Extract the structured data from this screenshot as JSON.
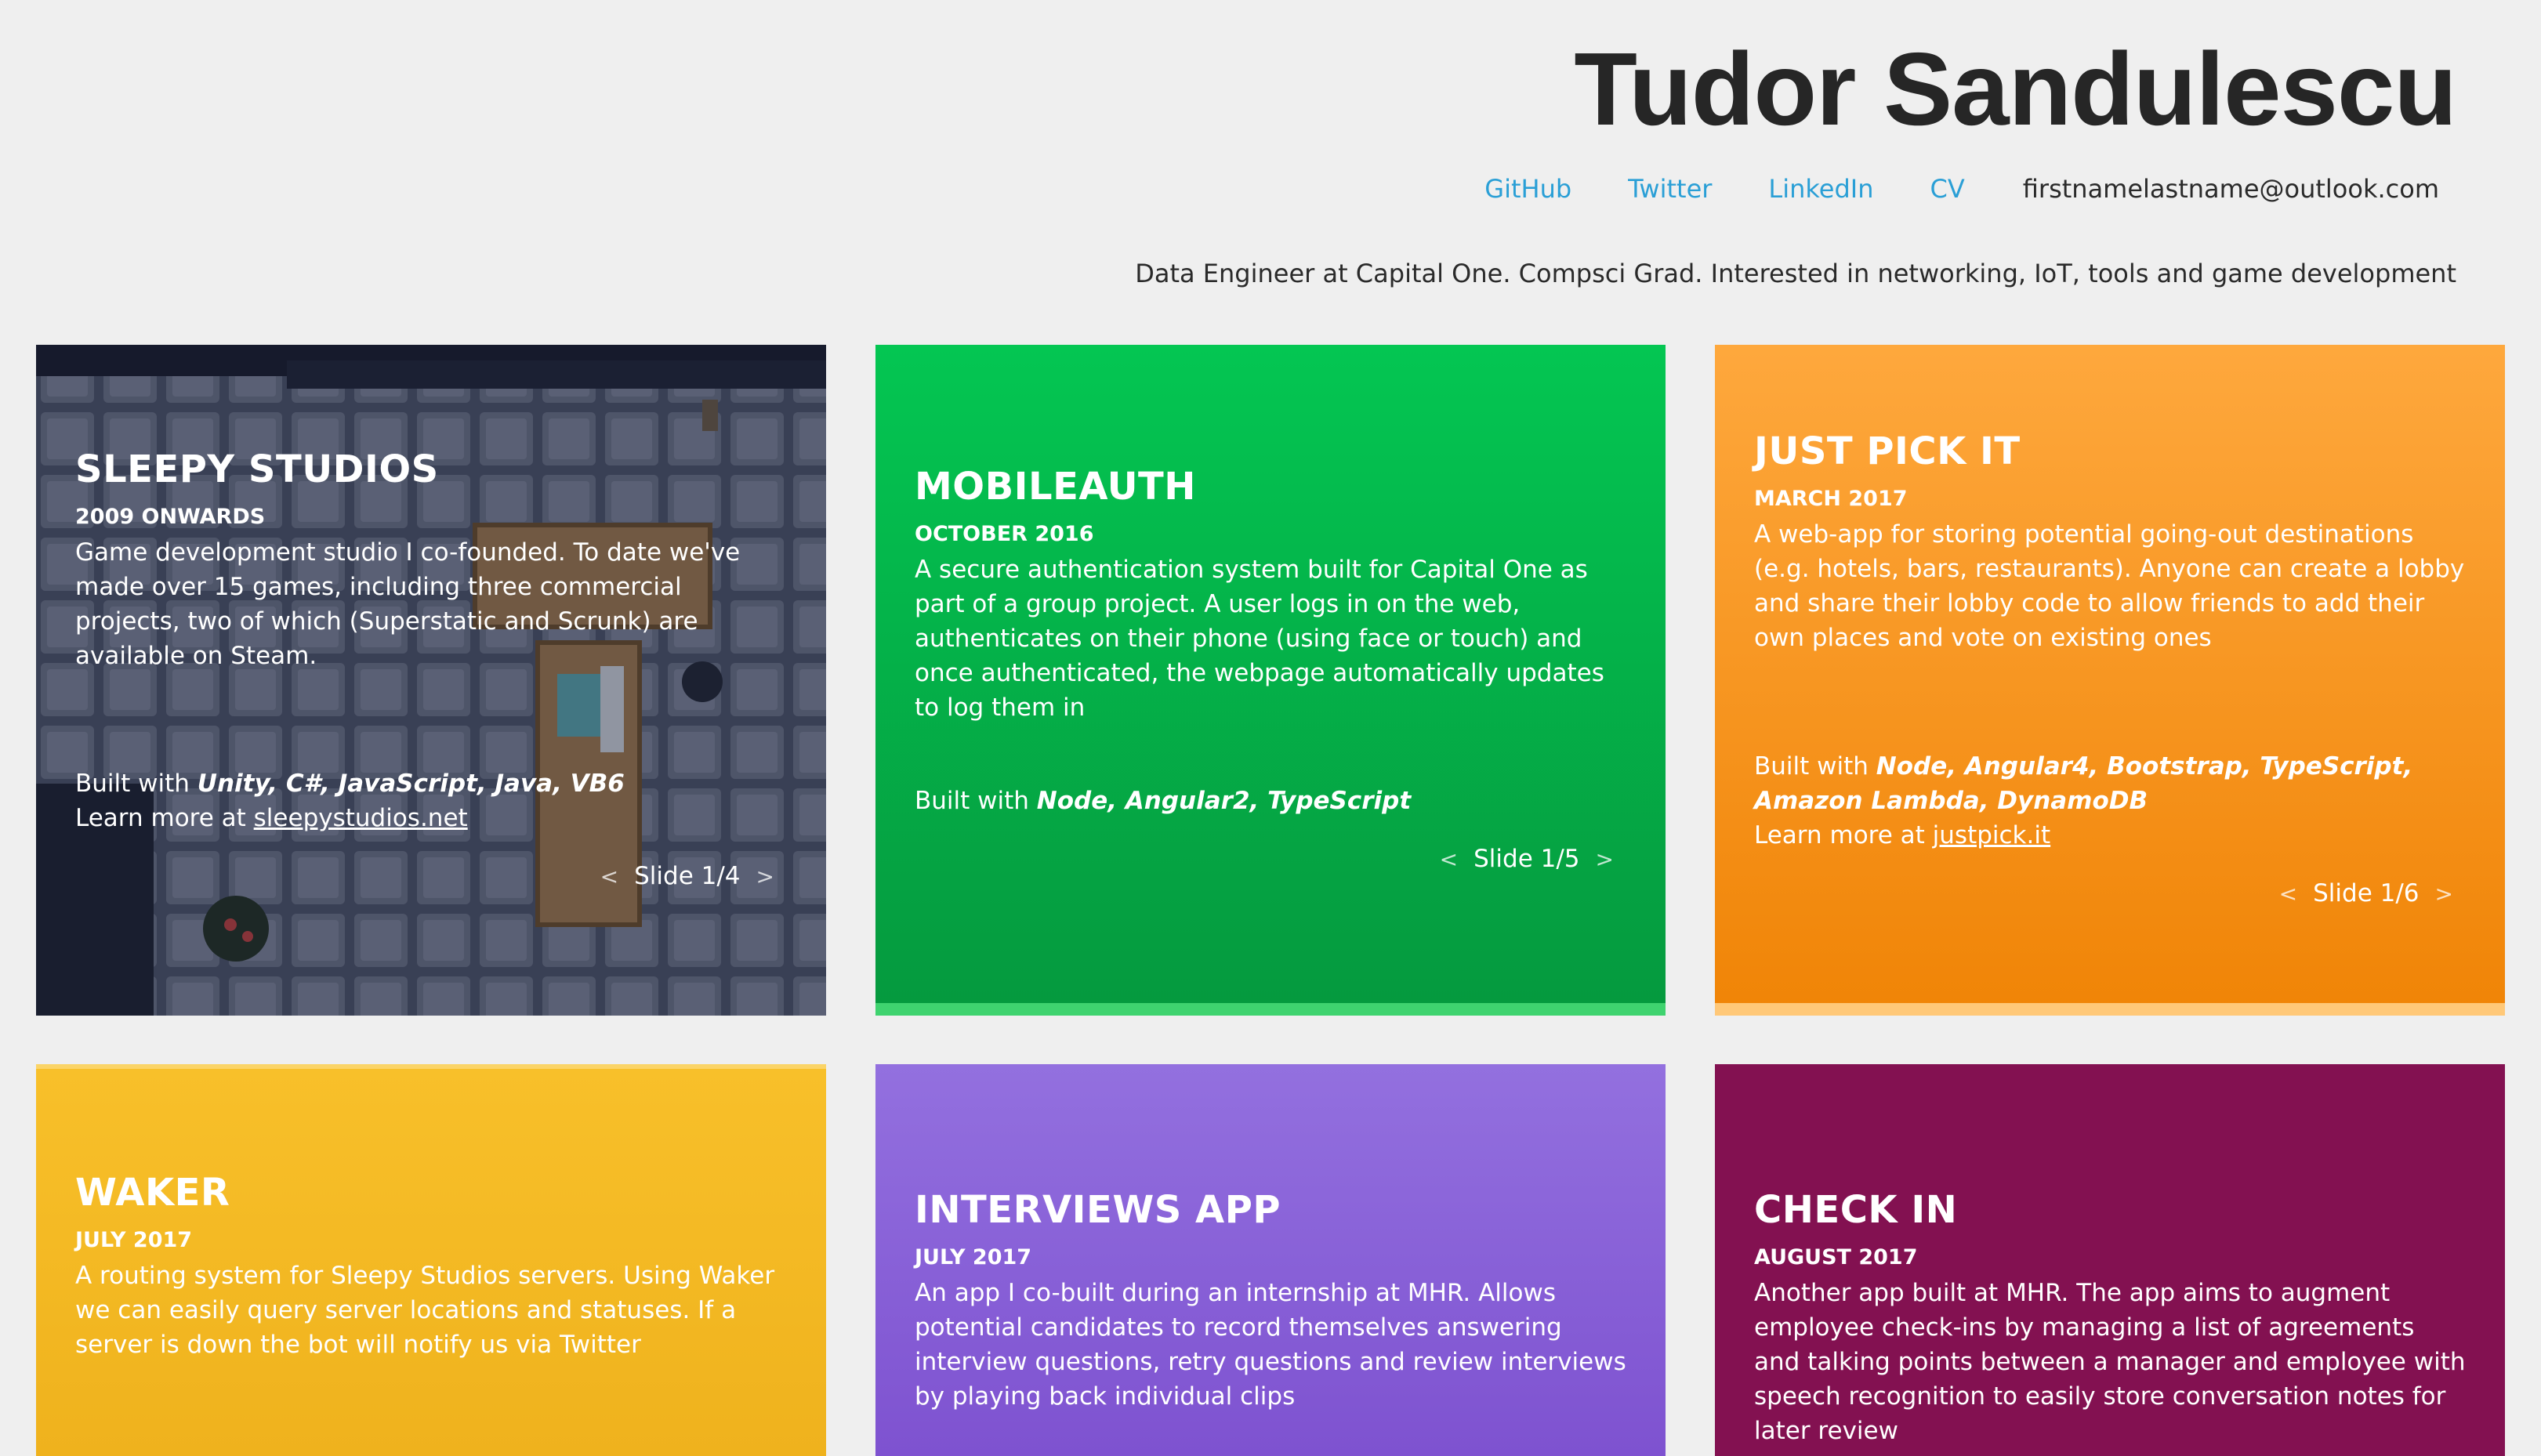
{
  "header": {
    "name": "Tudor Sandulescu",
    "links": [
      {
        "label": "GitHub"
      },
      {
        "label": "Twitter"
      },
      {
        "label": "LinkedIn"
      },
      {
        "label": "CV"
      }
    ],
    "email": "firstnamelastname@outlook.com",
    "tagline": "Data Engineer at Capital One. Compsci Grad. Interested in networking, IoT, tools and game development"
  },
  "colors": {
    "link": "#2a9fd6",
    "sleepy_bg": "#3c4256",
    "mobileauth_bg": "#04c652",
    "justpickit_bg": "#fea83d",
    "waker_bg": "#f8c02a",
    "interviews_bg": "#9370df",
    "checkin_bg": "#831151"
  },
  "projects": [
    {
      "title": "SLEEPY STUDIOS",
      "date": "2009 ONWARDS",
      "description": "Game development studio I co-founded. To date we've made over 15 games, including three commercial projects, two of which (Superstatic and Scrunk) are available on Steam.",
      "built_prefix": "Built with ",
      "built_with": "Unity, C#, JavaScript, Java, VB6",
      "learn_prefix": "Learn more at ",
      "learn_link": "sleepystudios.net",
      "slide": "Slide 1/4"
    },
    {
      "title": "MOBILEAUTH",
      "date": "OCTOBER 2016",
      "description": "A secure authentication system built for Capital One as part of a group project. A user logs in on the web, authenticates on their phone (using face or touch) and once authenticated, the webpage automatically updates to log them in",
      "built_prefix": "Built with ",
      "built_with": "Node, Angular2, TypeScript",
      "slide": "Slide 1/5"
    },
    {
      "title": "JUST PICK IT",
      "date": "MARCH 2017",
      "description": "A web-app for storing potential going-out destinations (e.g. hotels, bars, restaurants). Anyone can create a lobby and share their lobby code to allow friends to add their own places and vote on existing ones",
      "built_prefix": "Built with ",
      "built_with": "Node, Angular4, Bootstrap, TypeScript, Amazon Lambda, DynamoDB",
      "learn_prefix": "Learn more at ",
      "learn_link": "justpick.it",
      "slide": "Slide 1/6"
    },
    {
      "title": "WAKER",
      "date": "JULY 2017",
      "description": "A routing system for Sleepy Studios servers. Using Waker we can easily query server locations and statuses. If a server is down the bot will notify us via Twitter"
    },
    {
      "title": "INTERVIEWS APP",
      "date": "JULY 2017",
      "description": "An app I co-built during an internship at MHR. Allows potential candidates to record themselves answering interview questions, retry questions and review interviews by playing back individual clips"
    },
    {
      "title": "CHECK IN",
      "date": "AUGUST 2017",
      "description": "Another app built at MHR. The app aims to augment employee check-ins by managing a list of agreements and talking points between a manager and employee with speech recognition to easily store conversation notes for later review"
    }
  ],
  "arrows": {
    "prev": "<",
    "next": ">"
  }
}
